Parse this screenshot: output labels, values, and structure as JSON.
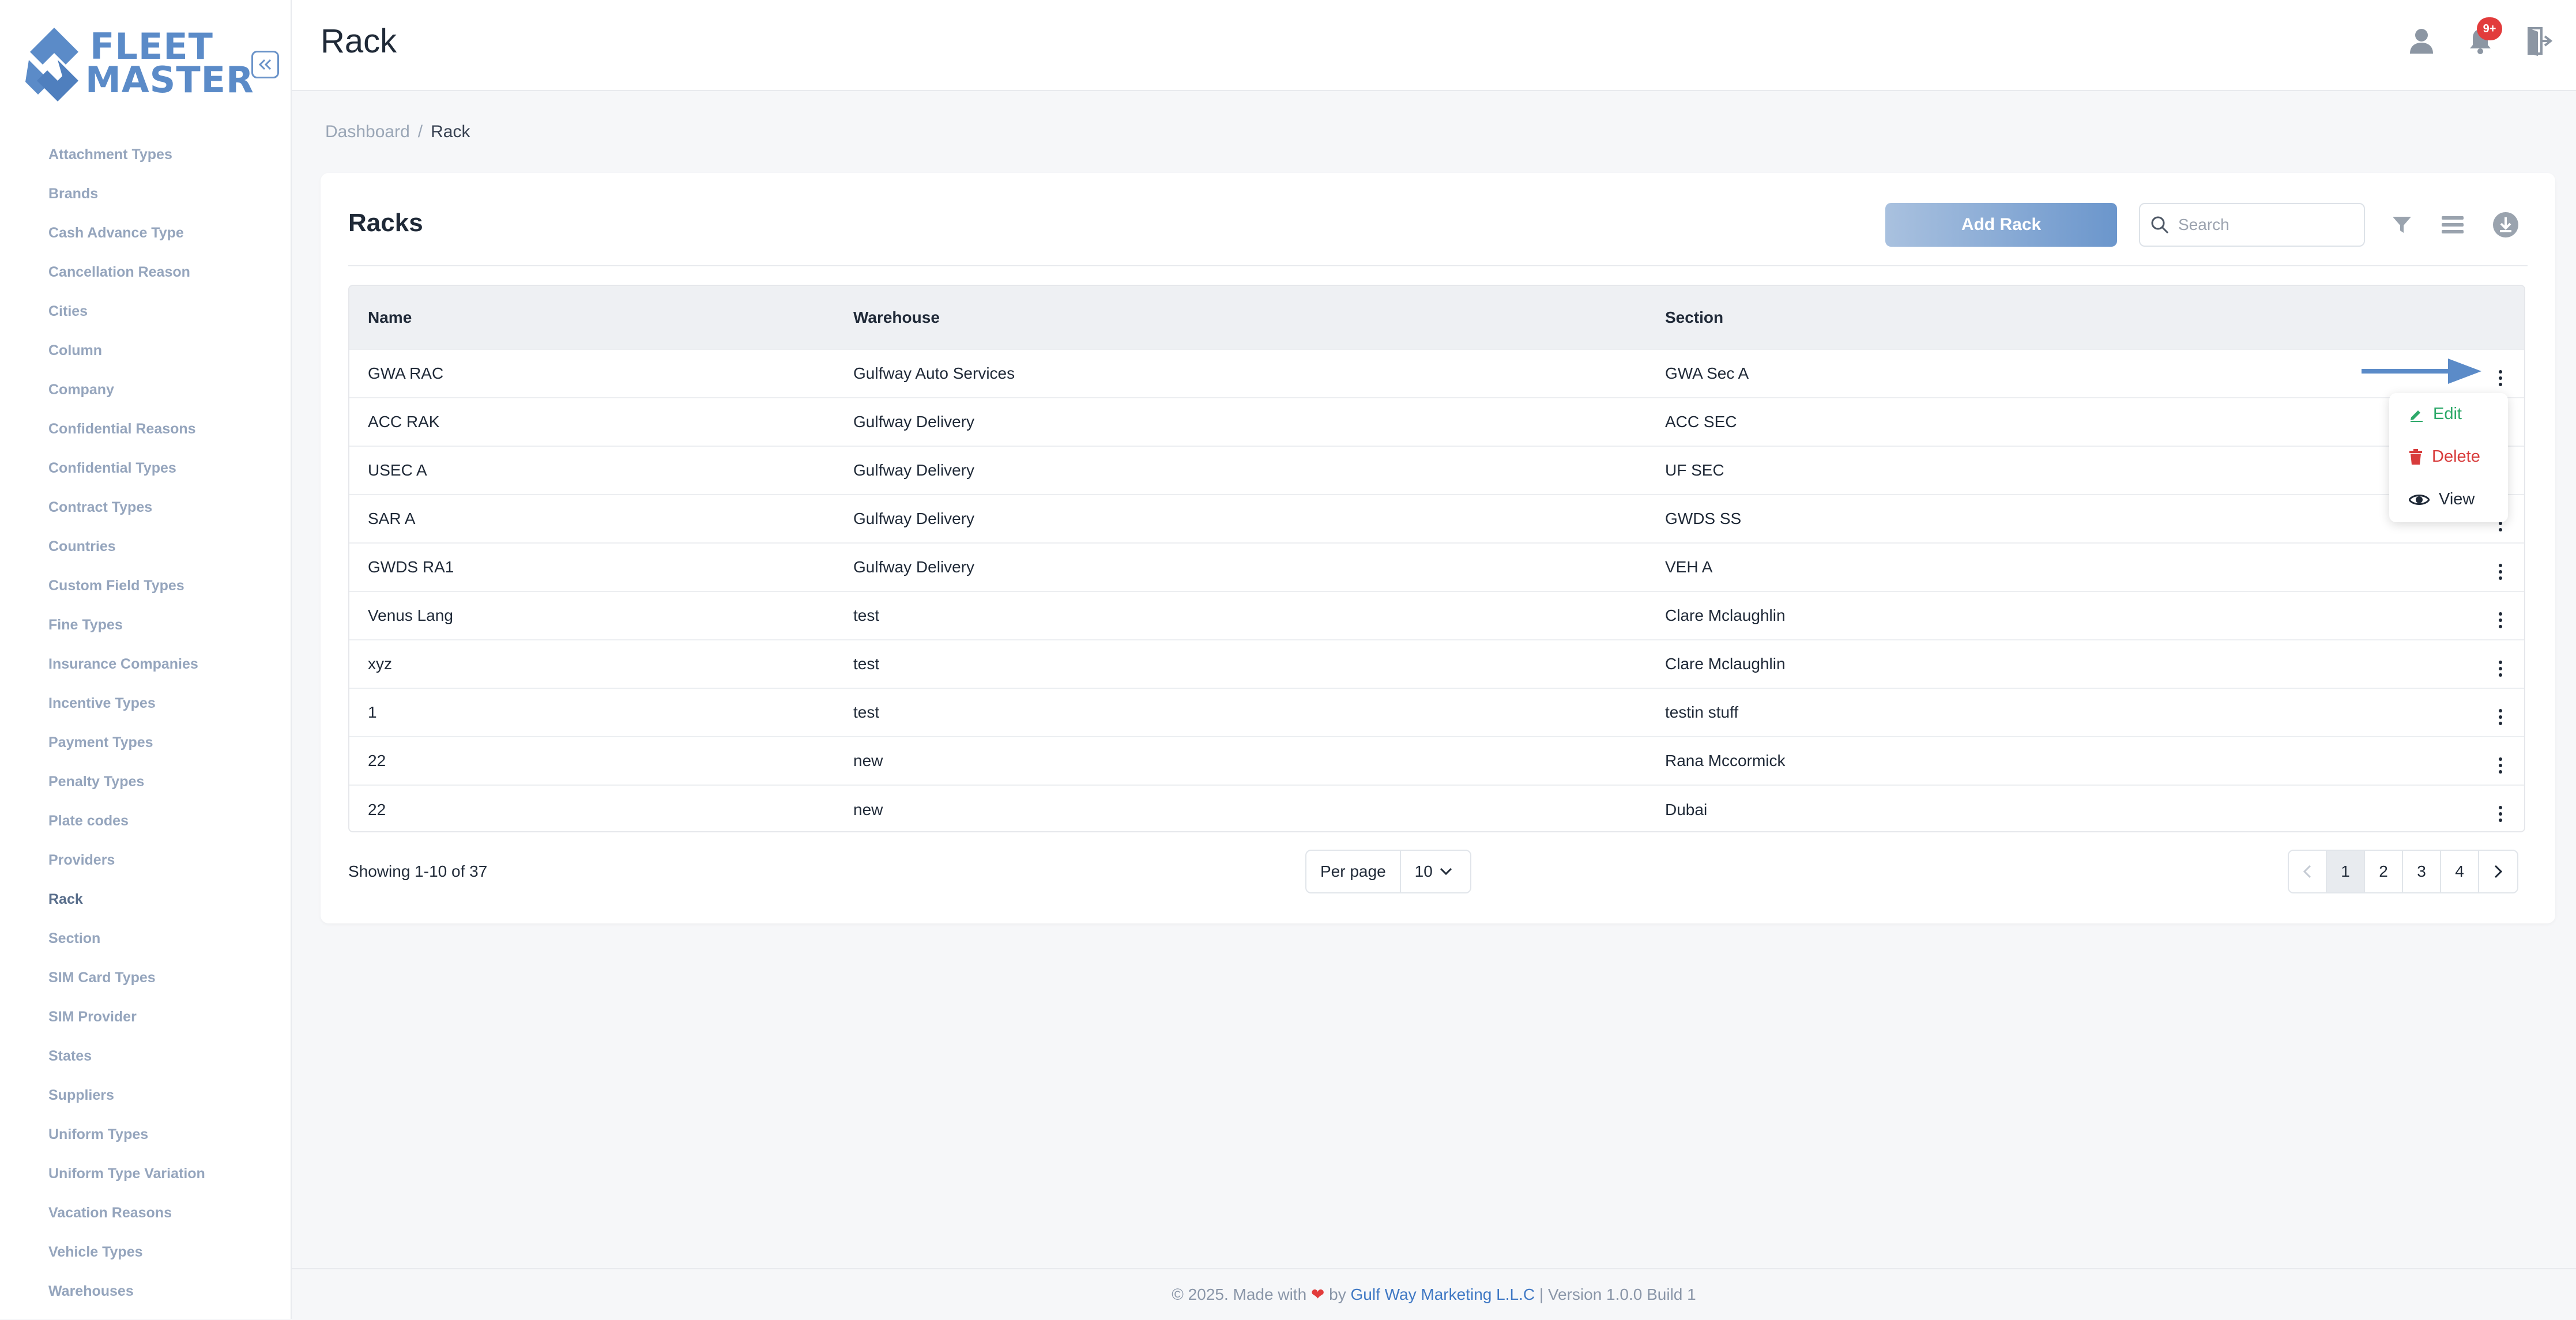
{
  "brand": {
    "line1": "FLEET",
    "line2": "MASTER"
  },
  "sidebar": {
    "items": [
      "Attachment Types",
      "Brands",
      "Cash Advance Type",
      "Cancellation Reason",
      "Cities",
      "Column",
      "Company",
      "Confidential Reasons",
      "Confidential Types",
      "Contract Types",
      "Countries",
      "Custom Field Types",
      "Fine Types",
      "Insurance Companies",
      "Incentive Types",
      "Payment Types",
      "Penalty Types",
      "Plate codes",
      "Providers",
      "Rack",
      "Section",
      "SIM Card Types",
      "SIM Provider",
      "States",
      "Suppliers",
      "Uniform Types",
      "Uniform Type Variation",
      "Vacation Reasons",
      "Vehicle Types",
      "Warehouses"
    ],
    "active": "Rack"
  },
  "header": {
    "title": "Rack",
    "notification_count": "9+"
  },
  "breadcrumb": {
    "home": "Dashboard",
    "separator": "/",
    "current": "Rack"
  },
  "card": {
    "title": "Racks",
    "add_label": "Add Rack",
    "search_placeholder": "Search"
  },
  "table": {
    "columns": [
      "Name",
      "Warehouse",
      "Section"
    ],
    "rows": [
      [
        "GWA RAC",
        "Gulfway Auto Services",
        "GWA Sec A"
      ],
      [
        "ACC RAK",
        "Gulfway Delivery",
        "ACC SEC"
      ],
      [
        "USEC A",
        "Gulfway Delivery",
        "UF SEC"
      ],
      [
        "SAR A",
        "Gulfway Delivery",
        "GWDS SS"
      ],
      [
        "GWDS RA1",
        "Gulfway Delivery",
        "VEH A"
      ],
      [
        "Venus Lang",
        "test",
        "Clare Mclaughlin"
      ],
      [
        "xyz",
        "test",
        "Clare Mclaughlin"
      ],
      [
        "1",
        "test",
        "testin stuff"
      ],
      [
        "22",
        "new",
        "Rana Mccormick"
      ],
      [
        "22",
        "new",
        "Dubai"
      ]
    ]
  },
  "row_menu": {
    "edit": "Edit",
    "delete": "Delete",
    "view": "View"
  },
  "pagination": {
    "showing": "Showing 1-10 of 37",
    "per_page_label": "Per page",
    "per_page_value": "10",
    "pages": [
      "1",
      "2",
      "3",
      "4"
    ],
    "current_page": "1"
  },
  "footer": {
    "prefix": "© 2025. Made with",
    "by": "by",
    "company": "Gulf Way Marketing L.L.C",
    "version": "| Version 1.0.0 Build 1"
  },
  "colors": {
    "accent": "#5b8bc8",
    "danger": "#d83b3b",
    "success": "#2ea96a"
  }
}
